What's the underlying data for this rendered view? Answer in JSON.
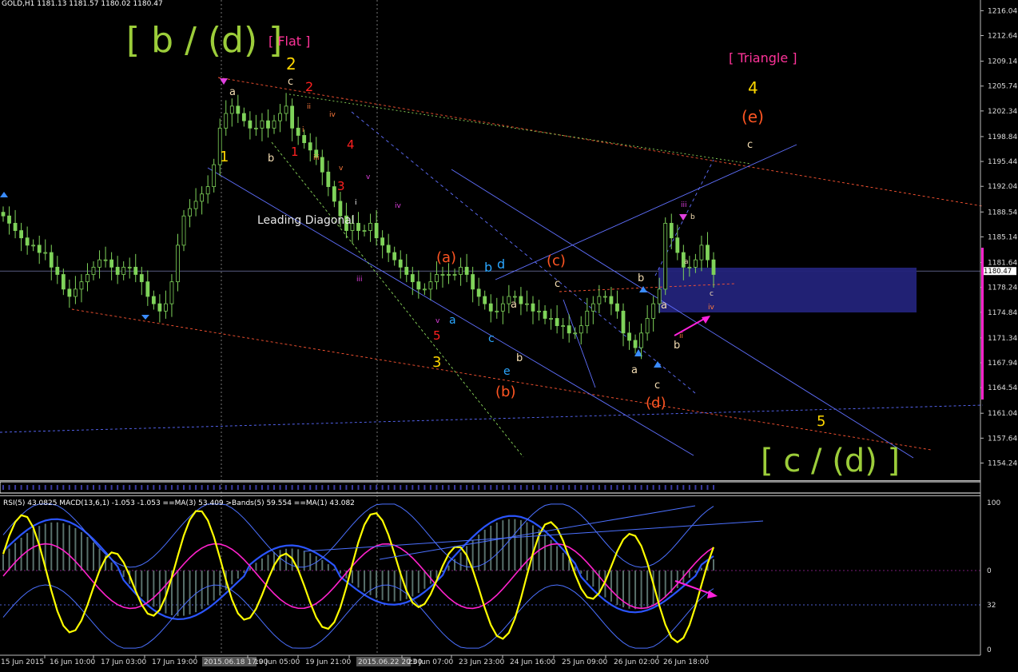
{
  "symbol_header": "GOLD,H1  1181.13 1181.57 1180.02 1180.47",
  "indicator_header": "RSI(5) 43.0825  MACD(13,6,1) -1.053 -1.053  ==MA(3) 53.409  >Bands(5) 59.554  ==MA(1) 43.082",
  "colors": {
    "bg": "#000000",
    "bull": "#7fd35a",
    "bear": "#7fd35a",
    "rsi": "#ffff00",
    "ma": "#ff22cc",
    "bands": "#4b70ff",
    "macd": "#6b8f8a"
  },
  "price_axis": {
    "ticks": [
      "1216.04",
      "1212.64",
      "1209.14",
      "1205.74",
      "1202.34",
      "1198.84",
      "1195.44",
      "1192.04",
      "1188.54",
      "1185.14",
      "1181.64",
      "1178.24",
      "1174.84",
      "1171.34",
      "1167.94",
      "1164.54",
      "1161.04",
      "1157.64",
      "1154.24"
    ],
    "current": "1180.47"
  },
  "indicator_axis": {
    "ticks": [
      "100",
      "0",
      "32",
      "0"
    ]
  },
  "time_axis": [
    "15 Jun 2015",
    "16 Jun 10:00",
    "17 Jun 03:00",
    "17 Jun 19:00",
    "2015.06.18 17:00",
    "19 Jun 05:00",
    "19 Jun 21:00",
    "2015.06.22 20:00",
    "23 Jun 07:00",
    "23 Jun 23:00",
    "24 Jun 16:00",
    "25 Jun 09:00",
    "26 Jun 02:00",
    "26 Jun 18:00"
  ],
  "labels": {
    "big_b_d": "[ b / (d) ]",
    "flat": "[ Flat ]",
    "triangle": "[ Triangle ]",
    "big_c_d": "[ c / (d) ]",
    "leading_diagonal": "Leading Diagonal",
    "w2": "2",
    "w4": "4",
    "w5": "5",
    "w1": "1",
    "w3": "3",
    "e_paren": "(e)",
    "a_paren": "(a)",
    "b_paren": "(b)",
    "c_paren": "(c)",
    "d_paren": "(d)",
    "red_2": "2",
    "red_1": "1",
    "red_3": "3",
    "red_4": "4",
    "red_5": "5",
    "a1": "a",
    "b1": "b",
    "c1": "c",
    "c2": "c",
    "b_blue": "b",
    "d_blue": "d",
    "a_blue": "a",
    "c_blue": "c",
    "e_blue": "e",
    "a_w1": "a",
    "b_w1": "b",
    "b_w2": "b",
    "a_w2": "a",
    "c_w2": "c",
    "a_w3": "a",
    "b_w3": "b",
    "i_1": "i",
    "i_2": "i",
    "ii_1": "ii",
    "iii_1": "iii",
    "iii_2": "iii",
    "iv_1": "iv",
    "iv_2": "iv",
    "v_1": "v",
    "v_2": "v",
    "v_3": "v",
    "iii_top": "iii",
    "b_top": "b",
    "a_small": "a",
    "c_small": "c",
    "iv_small": "iv",
    "ii_small": "ii"
  },
  "chart_data": {
    "type": "candlestick",
    "title": "GOLD,H1",
    "ylim": [
      1152.0,
      1217.5
    ],
    "close": [
      1188,
      1187,
      1186,
      1185,
      1184,
      1184,
      1183,
      1183,
      1181,
      1180,
      1178,
      1177,
      1178,
      1179,
      1180,
      1181,
      1182,
      1182,
      1181,
      1180,
      1181,
      1181,
      1180,
      1179,
      1177,
      1176,
      1175,
      1176,
      1179,
      1184,
      1188,
      1189,
      1190,
      1191,
      1192,
      1195,
      1200,
      1202,
      1203,
      1202,
      1201,
      1200,
      1200,
      1201,
      1200,
      1201,
      1202,
      1203,
      1200,
      1199,
      1198,
      1197,
      1196,
      1194,
      1192,
      1190,
      1188,
      1186,
      1187,
      1186,
      1186,
      1187,
      1185,
      1184,
      1183,
      1182,
      1181,
      1180,
      1179,
      1178,
      1178,
      1179,
      1180,
      1180,
      1180,
      1180,
      1181,
      1180,
      1178,
      1177,
      1176,
      1175,
      1175,
      1176,
      1177,
      1177,
      1176,
      1176,
      1175,
      1175,
      1174,
      1174,
      1173,
      1173,
      1172,
      1172,
      1173,
      1175,
      1176,
      1177,
      1177,
      1176,
      1175,
      1172,
      1171,
      1170,
      1172,
      1174,
      1176,
      1178,
      1187,
      1185,
      1183,
      1181,
      1181,
      1182,
      1184,
      1182,
      1180
    ]
  }
}
